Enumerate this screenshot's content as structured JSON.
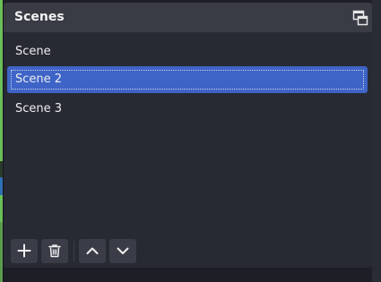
{
  "dock": {
    "title": "Scenes",
    "float_icon": "undock-window-icon"
  },
  "scenes": {
    "items": [
      {
        "label": "Scene",
        "selected": false
      },
      {
        "label": "Scene 2",
        "selected": true
      },
      {
        "label": "Scene 3",
        "selected": false
      }
    ]
  },
  "toolbar": {
    "add_icon": "plus-icon",
    "remove_icon": "trash-icon",
    "move_up_icon": "chevron-up-icon",
    "move_down_icon": "chevron-down-icon"
  },
  "colors": {
    "dock_bg": "#272a33",
    "header_bg": "#393b45",
    "selection": "#3f64c7",
    "button_bg": "#3a3c47",
    "text": "#eeeeee"
  }
}
